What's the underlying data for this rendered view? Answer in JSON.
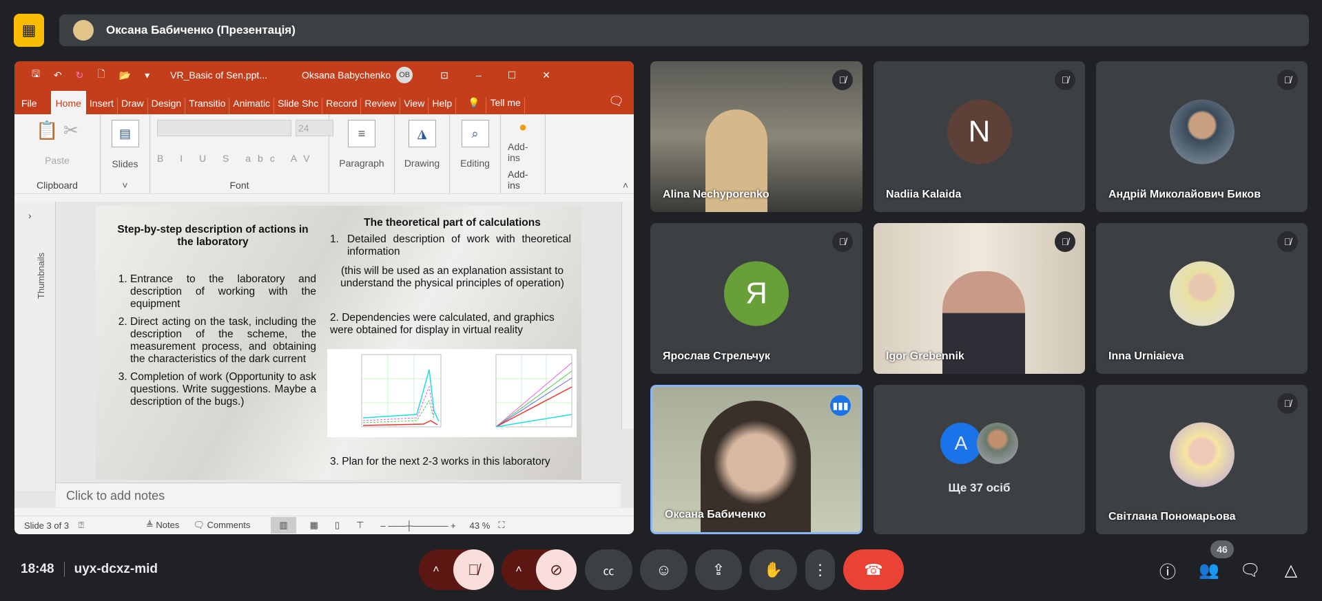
{
  "header": {
    "presenter_title": "Оксана Бабиченко (Презентація)",
    "logo_icon": "presentation-off-icon"
  },
  "ppt": {
    "file_name": "VR_Basic of Sen.ppt...",
    "user": "Oksana Babychenko",
    "user_initials": "OB",
    "tabs": [
      "File",
      "Home",
      "Insert",
      "Draw",
      "Design",
      "Transitio",
      "Animatic",
      "Slide Shc",
      "Record",
      "Review",
      "View",
      "Help",
      "Tell me"
    ],
    "ribbon": {
      "paste": "Paste",
      "clipboard": "Clipboard",
      "slides": "Slides",
      "font_size": "24",
      "font": "Font",
      "paragraph": "Paragraph",
      "drawing": "Drawing",
      "editing": "Editing",
      "addins": "Add-ins",
      "addins_group": "Add-ins"
    },
    "thumbnails": "Thumbnails",
    "slide": {
      "left_title": "Step-by-step description of actions in the laboratory",
      "left_items": [
        "Entrance to the laboratory and description of working with the equipment",
        "Direct acting on the task, including the description of the scheme, the measurement process, and obtaining the characteristics of the dark current",
        "Completion of work (Opportunity to ask questions. Write suggestions. Maybe a description of the bugs.)"
      ],
      "right_title": "The theoretical part of calculations",
      "right_item1": "Detailed description of work with theoretical information",
      "right_note": "(this will be used as an explanation assistant to understand the physical principles of operation)",
      "right_item2": "2. Dependencies were calculated, and graphics were obtained for display in virtual reality",
      "right_item3": "3. Plan for the next 2-3 works in this laboratory"
    },
    "notes_placeholder": "Click to add notes",
    "status": {
      "slide": "Slide 3 of 3",
      "notes": "Notes",
      "comments": "Comments",
      "zoom": "43 %"
    }
  },
  "participants": [
    {
      "name": "Alina Nechyporenko",
      "video": true,
      "muted": true
    },
    {
      "name": "Nadiia Kalaida",
      "initial": "N",
      "color": "#5d4037",
      "muted": true
    },
    {
      "name": "Андрій Миколайович Биков",
      "photo": true,
      "muted": true
    },
    {
      "name": "Ярослав Стрельчук",
      "initial": "Я",
      "color": "#689f38",
      "muted": true
    },
    {
      "name": "Igor Grebennik",
      "video": true,
      "muted": true
    },
    {
      "name": "Inna Urniaieva",
      "photo": true,
      "muted": true
    },
    {
      "name": "Оксана Бабиченко",
      "video": true,
      "speaking": true
    },
    {
      "name": "Ще 37 осіб",
      "initial": "A",
      "color": "#1a73e8"
    },
    {
      "name": "Світлана Пономарьова",
      "photo": true,
      "muted": true
    }
  ],
  "footer": {
    "time": "18:48",
    "meeting_code": "uyx-dcxz-mid",
    "people_count": "46",
    "end_color": "#ea4335"
  }
}
